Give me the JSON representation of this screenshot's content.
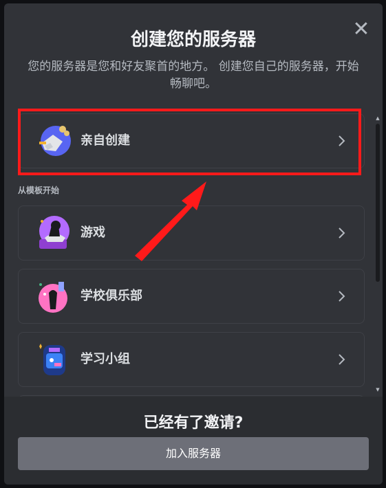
{
  "dialog": {
    "title": "创建您的服务器",
    "subtitle": "您的服务器是您和好友聚首的地方。 创建您自己的服务器，开始畅聊吧。"
  },
  "create_own": {
    "label": "亲自创建",
    "icon": "create-own-icon"
  },
  "templates": {
    "section_label": "从模板开始",
    "items": [
      {
        "label": "游戏",
        "icon": "gaming-icon"
      },
      {
        "label": "学校俱乐部",
        "icon": "school-club-icon"
      },
      {
        "label": "学习小组",
        "icon": "study-group-icon"
      }
    ]
  },
  "footer": {
    "title": "已经有了邀请?",
    "join_label": "加入服务器"
  },
  "colors": {
    "highlight": "#ff1a1a",
    "modal_bg": "#313338",
    "footer_bg": "#2b2d31",
    "join_button_bg": "#6d6f78"
  }
}
